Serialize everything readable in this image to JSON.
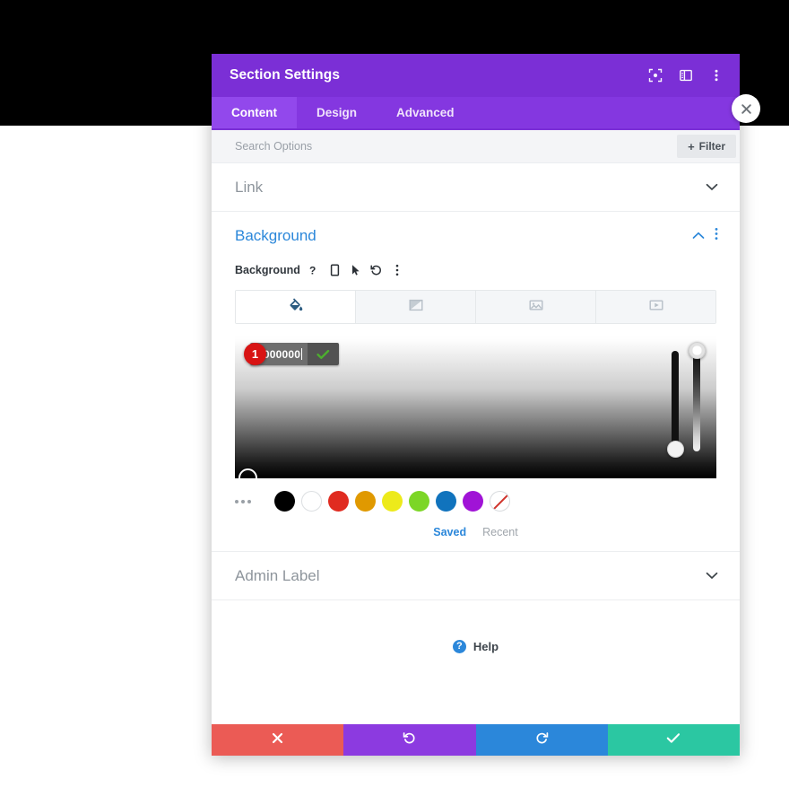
{
  "window": {
    "title": "Section Settings",
    "header_icons": [
      {
        "name": "fullscreen-icon",
        "glyph": "expand"
      },
      {
        "name": "layout-split-icon",
        "glyph": "columns"
      },
      {
        "name": "more-options-icon",
        "glyph": "kebab"
      }
    ],
    "close_label": "✕"
  },
  "tabs": [
    {
      "label": "Content",
      "active": true
    },
    {
      "label": "Design",
      "active": false
    },
    {
      "label": "Advanced",
      "active": false
    }
  ],
  "search": {
    "placeholder": "Search Options",
    "value": "",
    "filter_label": "Filter",
    "filter_plus": "+"
  },
  "sections": [
    {
      "label": "Link",
      "state": "collapsed",
      "chevron": "chevron-down"
    },
    {
      "label": "Background",
      "state": "expanded",
      "chevron": "chevron-up"
    },
    {
      "label": "Admin Label",
      "state": "collapsed",
      "chevron": "chevron-down"
    }
  ],
  "background": {
    "title": "Background",
    "control_label": "Background",
    "control_icons": [
      {
        "name": "help-icon",
        "glyph": "?"
      },
      {
        "name": "responsive-phone-icon",
        "glyph": "phone"
      },
      {
        "name": "hover-cursor-icon",
        "glyph": "cursor"
      },
      {
        "name": "reset-icon",
        "glyph": "undo"
      },
      {
        "name": "option-menu-icon",
        "glyph": "kebab"
      }
    ],
    "type_tabs": [
      {
        "name": "background-color-tab",
        "icon": "paint-bucket-icon",
        "active": true
      },
      {
        "name": "background-gradient-tab",
        "icon": "gradient-icon",
        "active": false
      },
      {
        "name": "background-image-tab",
        "icon": "image-icon",
        "active": false
      },
      {
        "name": "background-video-tab",
        "icon": "video-icon",
        "active": false
      }
    ],
    "picker": {
      "hex_value": "#000000",
      "confirm_icon": "checkmark-icon",
      "badge_number": "1",
      "hue_slider_name": "hue-slider",
      "alpha_slider_name": "alpha-slider",
      "saturation_handle_name": "saturation-handle"
    },
    "swatches": [
      {
        "name": "swatch-more",
        "color": ""
      },
      {
        "name": "swatch-black",
        "color": "#000000"
      },
      {
        "name": "swatch-white",
        "color": "#ffffff"
      },
      {
        "name": "swatch-red",
        "color": "#e02b20"
      },
      {
        "name": "swatch-orange",
        "color": "#e09900"
      },
      {
        "name": "swatch-yellow",
        "color": "#edea1b"
      },
      {
        "name": "swatch-green",
        "color": "#7cd626"
      },
      {
        "name": "swatch-blue",
        "color": "#1073bd"
      },
      {
        "name": "swatch-purple",
        "color": "#a013d6"
      },
      {
        "name": "swatch-none",
        "color": "transparent"
      }
    ],
    "palette_tabs": [
      {
        "label": "Saved",
        "active": true
      },
      {
        "label": "Recent",
        "active": false
      }
    ]
  },
  "help": {
    "icon": "help-circle-icon",
    "glyph": "?",
    "label": "Help"
  },
  "footer": [
    {
      "name": "cancel-button",
      "icon": "close-x-icon",
      "color": "#eb5b55"
    },
    {
      "name": "undo-button",
      "icon": "undo-arrow-icon",
      "color": "#8c3ae0"
    },
    {
      "name": "redo-button",
      "icon": "redo-arrow-icon",
      "color": "#2b87da"
    },
    {
      "name": "save-button",
      "icon": "checkmark-icon",
      "color": "#2bc7a2"
    }
  ],
  "colors": {
    "header_purple": "#7b2fd6",
    "tabbar_purple": "#8437e0",
    "accent_blue": "#2b87da",
    "badge_red": "#d81414"
  }
}
